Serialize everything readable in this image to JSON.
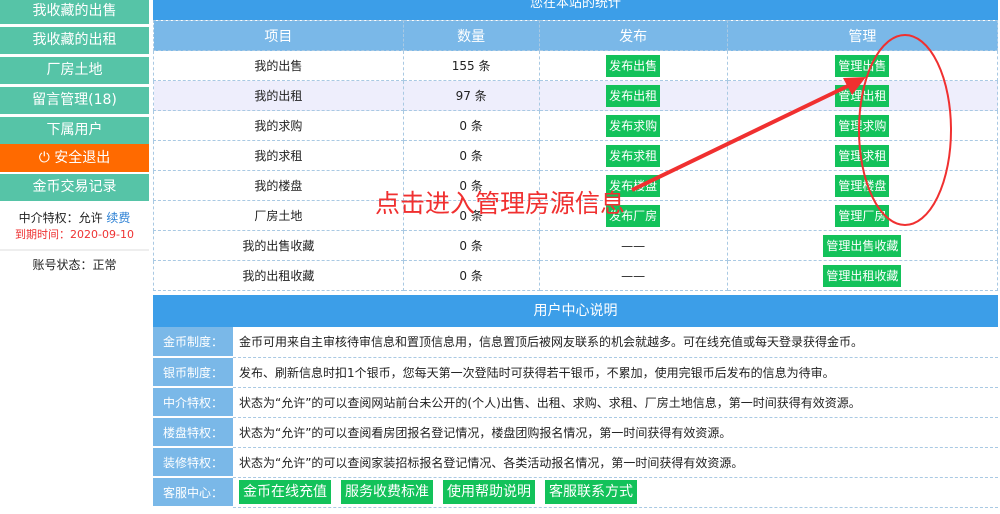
{
  "sidebar": {
    "items": [
      "我收藏的出售",
      "我收藏的出租",
      "厂房土地",
      "留言管理(18)",
      "下属用户"
    ],
    "logout": "安全退出",
    "coin_record": "金币交易记录",
    "agent_label": "中介特权：允许",
    "renew": "续费",
    "expiry": "到期时间：2020-09-10",
    "account_status": "账号状态：正常"
  },
  "stats": {
    "title": "您在本站的统计",
    "headers": [
      "项目",
      "数量",
      "发布",
      "管理"
    ],
    "rows": [
      {
        "item": "我的出售",
        "count": "155 条",
        "publish": "发布出售",
        "manage": "管理出售"
      },
      {
        "item": "我的出租",
        "count": "97 条",
        "publish": "发布出租",
        "manage": "管理出租"
      },
      {
        "item": "我的求购",
        "count": "0 条",
        "publish": "发布求购",
        "manage": "管理求购"
      },
      {
        "item": "我的求租",
        "count": "0 条",
        "publish": "发布求租",
        "manage": "管理求租"
      },
      {
        "item": "我的楼盘",
        "count": "0 条",
        "publish": "发布楼盘",
        "manage": "管理楼盘"
      },
      {
        "item": "厂房土地",
        "count": "0 条",
        "publish": "发布厂房",
        "manage": "管理厂房"
      },
      {
        "item": "我的出售收藏",
        "count": "0 条",
        "publish": "——",
        "manage": "管理出售收藏"
      },
      {
        "item": "我的出租收藏",
        "count": "0 条",
        "publish": "——",
        "manage": "管理出租收藏"
      }
    ]
  },
  "info": {
    "title": "用户中心说明",
    "rows": [
      {
        "label": "金币制度：",
        "text": "金币可用来自主审核待审信息和置顶信息用，信息置顶后被网友联系的机会就越多。可在线充值或每天登录获得金币。"
      },
      {
        "label": "银币制度：",
        "text": "发布、刷新信息时扣1个银币，您每天第一次登陆时可获得若干银币，不累加，使用完银币后发布的信息为待审。"
      },
      {
        "label": "中介特权：",
        "text": "状态为“允许”的可以查阅网站前台未公开的(个人)出售、出租、求购、求租、厂房土地信息，第一时间获得有效资源。"
      },
      {
        "label": "楼盘特权：",
        "text": "状态为“允许”的可以查阅看房团报名登记情况，楼盘团购报名情况，第一时间获得有效资源。"
      },
      {
        "label": "装修特权：",
        "text": "状态为“允许”的可以查阅家装招标报名登记情况、各类活动报名情况，第一时间获得有效资源。"
      }
    ],
    "service_label": "客服中心：",
    "service_buttons": [
      "金币在线充值",
      "服务收费标准",
      "使用帮助说明",
      "客服联系方式"
    ]
  },
  "annotation": {
    "text": "点击进入管理房源信息",
    "color": "#f03030"
  }
}
